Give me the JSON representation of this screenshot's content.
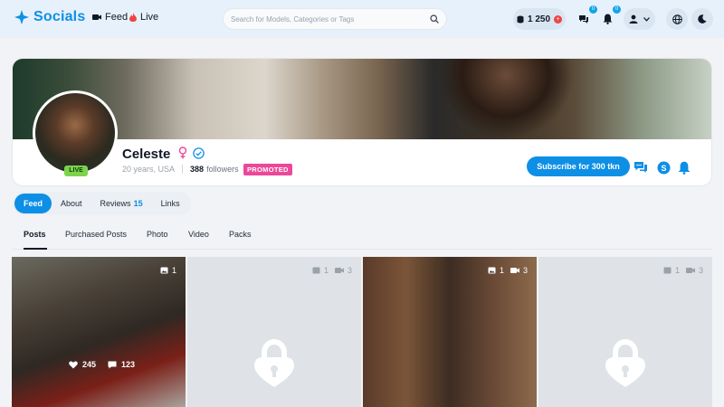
{
  "header": {
    "brand": "Socials",
    "nav": [
      {
        "label": "Feed",
        "icon": "video-camera-icon"
      },
      {
        "label": "Live",
        "icon": "flame-icon"
      }
    ],
    "search_placeholder": "Search for Models, Categories or Tags",
    "tokens": "1 250",
    "messages_badge": "0",
    "notifications_badge": "0",
    "accent_color": "#0d8fe6"
  },
  "profile": {
    "name": "Celeste",
    "age_location": "20 years, USA",
    "followers_count": "388",
    "followers_label": "followers",
    "promoted_label": "PROMOTED",
    "live_label": "LIVE",
    "subscribe_label": "Subscribe for 300 tkn"
  },
  "tabs": {
    "main": [
      {
        "label": "Feed",
        "active": true
      },
      {
        "label": "About"
      },
      {
        "label": "Reviews",
        "count": "15"
      },
      {
        "label": "Links"
      }
    ],
    "sub": [
      {
        "label": "Posts",
        "active": true
      },
      {
        "label": "Purchased Posts"
      },
      {
        "label": "Photo"
      },
      {
        "label": "Video"
      },
      {
        "label": "Packs"
      }
    ]
  },
  "posts": [
    {
      "photos": "1",
      "likes": "245",
      "comments": "123",
      "locked": false
    },
    {
      "photos": "1",
      "videos": "3",
      "locked": true
    },
    {
      "photos": "1",
      "videos": "3",
      "locked": false
    },
    {
      "photos": "1",
      "videos": "3",
      "locked": true
    }
  ]
}
